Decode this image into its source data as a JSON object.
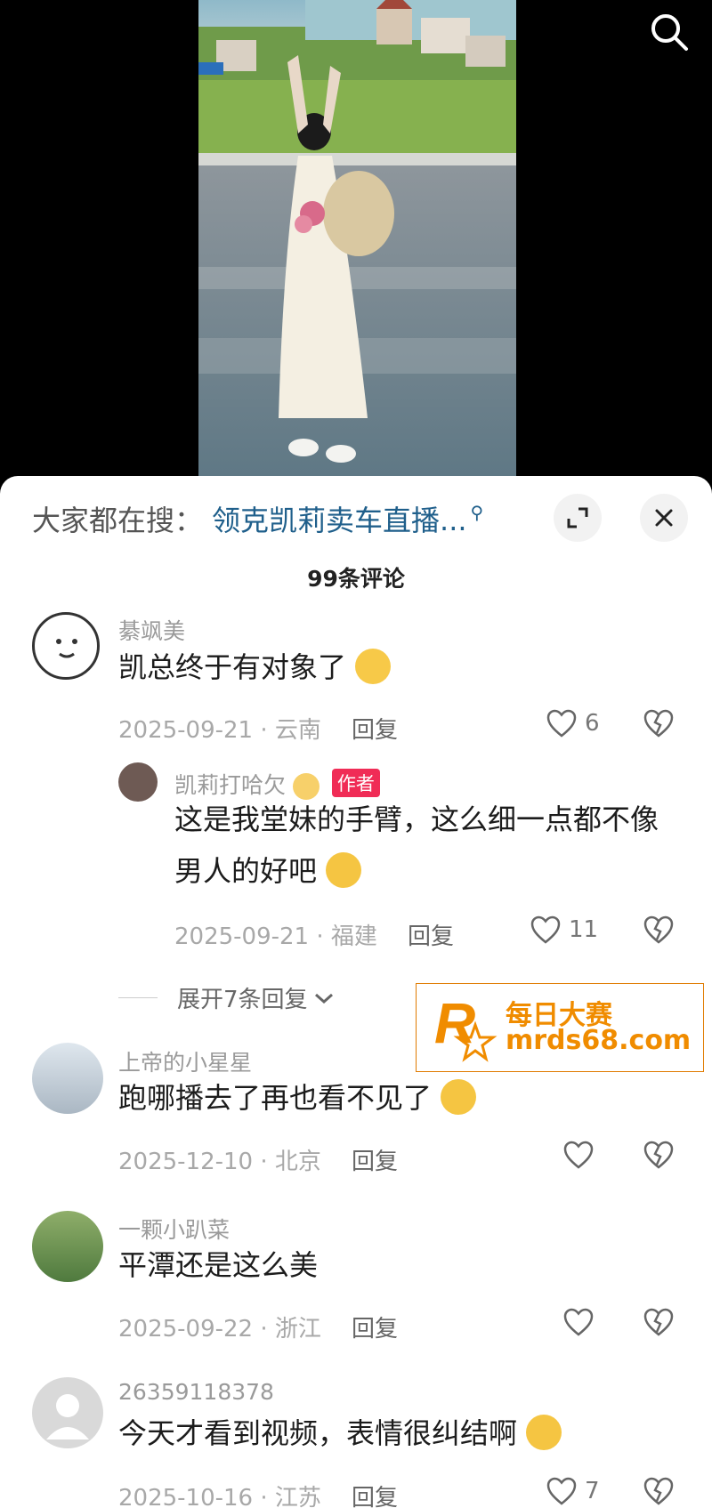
{
  "header": {
    "search_prefix": "大家都在搜：",
    "search_term": "领克凯莉卖车直播..."
  },
  "comment_count": "99条评论",
  "comments": [
    {
      "name": "綦飒美",
      "text": "凯总终于有对象了",
      "date": "2025-09-21 · 云南",
      "reply": "回复",
      "likes": "6"
    },
    {
      "name": "凯莉打哈欠",
      "badge": "作者",
      "text_line1": "这是我堂妹的手臂，这么细一点都不像",
      "text_line2": "男人的好吧",
      "date": "2025-09-21 · 福建",
      "reply": "回复",
      "likes": "11"
    },
    {
      "name": "上帝的小星星",
      "text": "跑哪播去了再也看不见了",
      "date": "2025-12-10 · 北京",
      "reply": "回复",
      "likes": ""
    },
    {
      "name": "一颗小趴菜",
      "text": "平潭还是这么美",
      "date": "2025-09-22 · 浙江",
      "reply": "回复",
      "likes": ""
    },
    {
      "name": "26359118378",
      "text": "今天才看到视频，表情很纠结啊",
      "date": "2025-10-16 · 江苏",
      "reply": "回复",
      "likes": "7"
    }
  ],
  "expand_replies": "展开7条回复",
  "watermark": {
    "line1": "每日大赛",
    "line2": "mrds68.com",
    "logo_letter": "R"
  },
  "icons": {
    "search": "search-icon",
    "expand": "expand-icon",
    "close": "close-icon",
    "like": "heart-icon",
    "dislike": "broken-heart-icon"
  },
  "colors": {
    "accent_blue": "#1f5f8b",
    "author_badge": "#f02c56",
    "watermark_orange": "#f08c00"
  }
}
